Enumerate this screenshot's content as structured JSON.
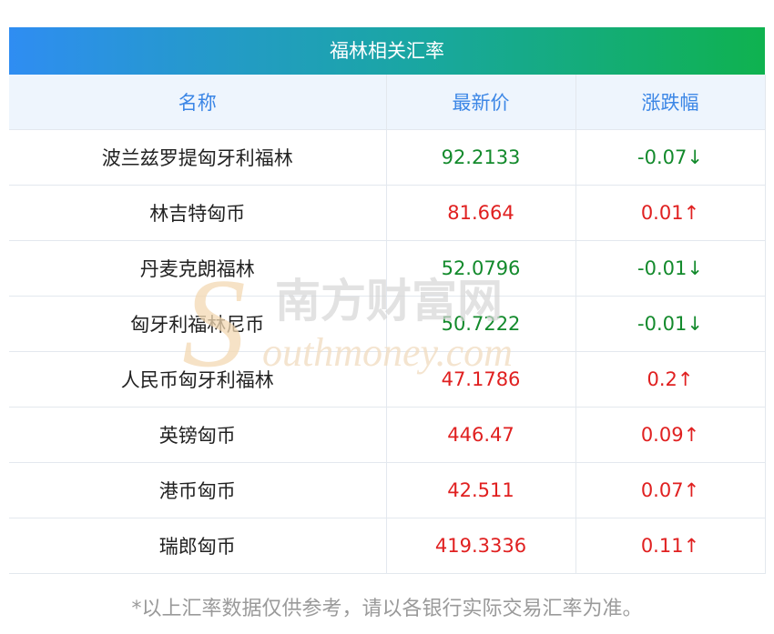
{
  "title": "福林相关汇率",
  "headers": [
    "名称",
    "最新价",
    "涨跌幅"
  ],
  "rows": [
    {
      "name": "波兰兹罗提匈牙利福林",
      "price": "92.2133",
      "change": "-0.07↓",
      "direction": "down"
    },
    {
      "name": "林吉特匈币",
      "price": "81.664",
      "change": "0.01↑",
      "direction": "up"
    },
    {
      "name": "丹麦克朗福林",
      "price": "52.0796",
      "change": "-0.01↓",
      "direction": "down"
    },
    {
      "name": "匈牙利福林尼币",
      "price": "50.7222",
      "change": "-0.01↓",
      "direction": "down"
    },
    {
      "name": "人民币匈牙利福林",
      "price": "47.1786",
      "change": "0.2↑",
      "direction": "up"
    },
    {
      "name": "英镑匈币",
      "price": "446.47",
      "change": "0.09↑",
      "direction": "up"
    },
    {
      "name": "港币匈币",
      "price": "42.511",
      "change": "0.07↑",
      "direction": "up"
    },
    {
      "name": "瑞郎匈币",
      "price": "419.3336",
      "change": "0.11↑",
      "direction": "up"
    }
  ],
  "watermark": {
    "cn": "南方财富网",
    "en": "outhmoney.com",
    "initial": "S"
  },
  "footnote": "*以上汇率数据仅供参考，请以各银行实际交易汇率为准。",
  "colors": {
    "up": "#e02020",
    "down": "#138a2c",
    "header_text": "#3b86e6"
  }
}
